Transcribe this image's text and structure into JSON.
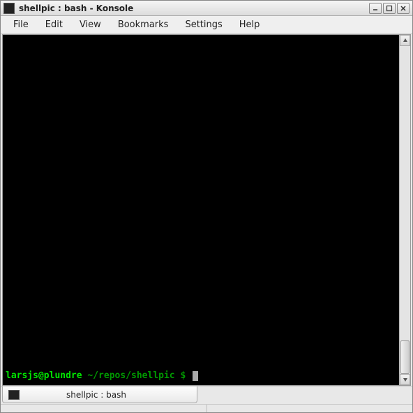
{
  "window": {
    "title": "shellpic : bash - Konsole"
  },
  "menubar": {
    "items": [
      "File",
      "Edit",
      "View",
      "Bookmarks",
      "Settings",
      "Help"
    ]
  },
  "terminal": {
    "prompt_user_host": "larsjs@plundre",
    "prompt_path": "~/repos/shellpic",
    "prompt_symbol": "$"
  },
  "tab": {
    "label": "shellpic : bash"
  }
}
